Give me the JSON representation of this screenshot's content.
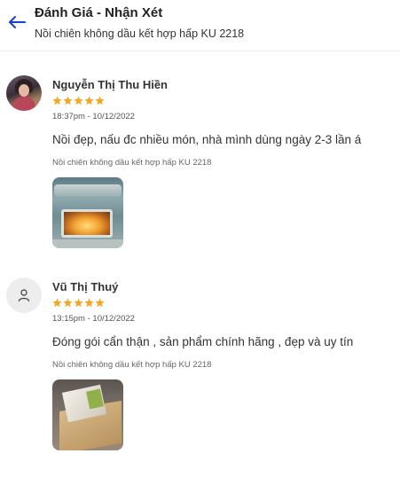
{
  "header": {
    "title": "Đánh Giá - Nhận Xét",
    "subtitle": "Nồi chiên không dầu kết hợp hấp KU 2218",
    "back_icon": "arrow-left-icon"
  },
  "colors": {
    "accent": "#1a3fd1",
    "star": "#f5a623"
  },
  "reviews": [
    {
      "name": "Nguyễn Thị Thu Hiền",
      "rating": 5,
      "timestamp": "18:37pm - 10/12/2022",
      "comment": "Nồi đẹp, nấu đc nhiều món, nhà mình dùng ngày 2-3 lần á",
      "variant": "Nồi chiên không dầu kết hợp hấp KU 2218",
      "avatar": "user-photo",
      "photo": "air-fryer-photo"
    },
    {
      "name": "Vũ Thị Thuý",
      "rating": 5,
      "timestamp": "13:15pm - 10/12/2022",
      "comment": "Đóng gói cẩn thận , sản phẩm chính hãng , đẹp và uy tín",
      "variant": "Nồi chiên không dầu kết hợp hấp KU 2218",
      "avatar": "default-user-icon",
      "photo": "package-photo"
    }
  ]
}
